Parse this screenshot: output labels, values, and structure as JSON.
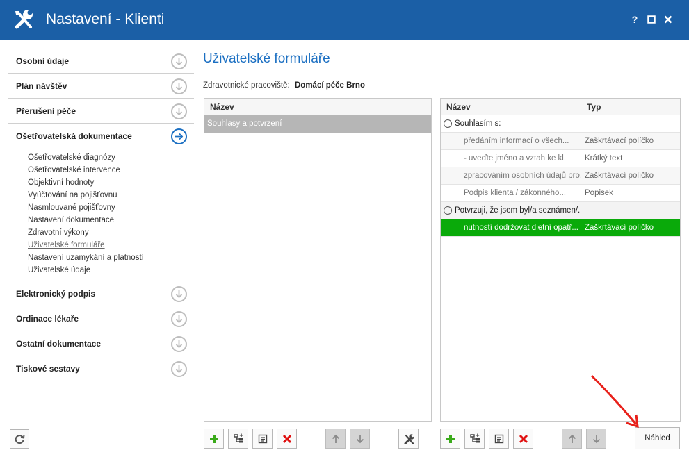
{
  "window": {
    "title": "Nastavení - Klienti",
    "controls": {
      "help": "?",
      "maximize": "□",
      "close": "✕"
    }
  },
  "sidebar": {
    "sections_top": [
      {
        "label": "Osobní údaje"
      },
      {
        "label": "Plán návštěv"
      },
      {
        "label": "Přerušení péče"
      }
    ],
    "active_section": {
      "label": "Ošetřovatelská dokumentace",
      "items": [
        "Ošetřovatelské diagnózy",
        "Ošetřovatelské intervence",
        "Objektivní hodnoty",
        "Vyúčtování na pojišťovnu",
        "Nasmlouvané pojišťovny",
        "Nastavení dokumentace",
        "Zdravotní výkony",
        "Uživatelské formuláře",
        "Nastavení uzamykání a platností",
        "Uživatelské údaje"
      ],
      "selected_item": "Uživatelské formuláře"
    },
    "sections_bottom": [
      {
        "label": "Elektronický podpis"
      },
      {
        "label": "Ordinace lékaře"
      },
      {
        "label": "Ostatní dokumentace"
      },
      {
        "label": "Tiskové sestavy"
      }
    ]
  },
  "main": {
    "title": "Uživatelské formuláře",
    "workplace_label": "Zdravotnické pracoviště:",
    "workplace_value": "Domácí péče Brno",
    "left_grid": {
      "column_name": "Název",
      "rows": [
        "Souhlasy a potvrzení"
      ]
    },
    "right_grid": {
      "column_name": "Název",
      "column_type": "Typ",
      "rows": [
        {
          "kind": "group",
          "name": "Souhlasím s:",
          "type": ""
        },
        {
          "kind": "child",
          "name": "předáním informací o všech...",
          "type": "Zaškrtávací políčko"
        },
        {
          "kind": "child",
          "name": "- uveďte jméno a vztah ke kl.",
          "type": "Krátký text"
        },
        {
          "kind": "child",
          "name": "zpracováním osobních údajů pro...",
          "type": "Zaškrtávací políčko"
        },
        {
          "kind": "child",
          "name": "Podpis klienta / zákonného...",
          "type": "Popisek"
        },
        {
          "kind": "group",
          "name": "Potvrzuji, že jsem byl/a seznámen/...",
          "type": ""
        },
        {
          "kind": "selected",
          "name": "nutností dodržovat dietní opatř...",
          "type": "Zaškrtávací políčko"
        }
      ]
    },
    "preview_button": "Náhled"
  },
  "colors": {
    "titlebar": "#1b5fa6",
    "accent": "#1b6fc2",
    "selected_row": "#0aaa0a",
    "delete_red": "#e01010",
    "add_green": "#3aaa1a"
  }
}
